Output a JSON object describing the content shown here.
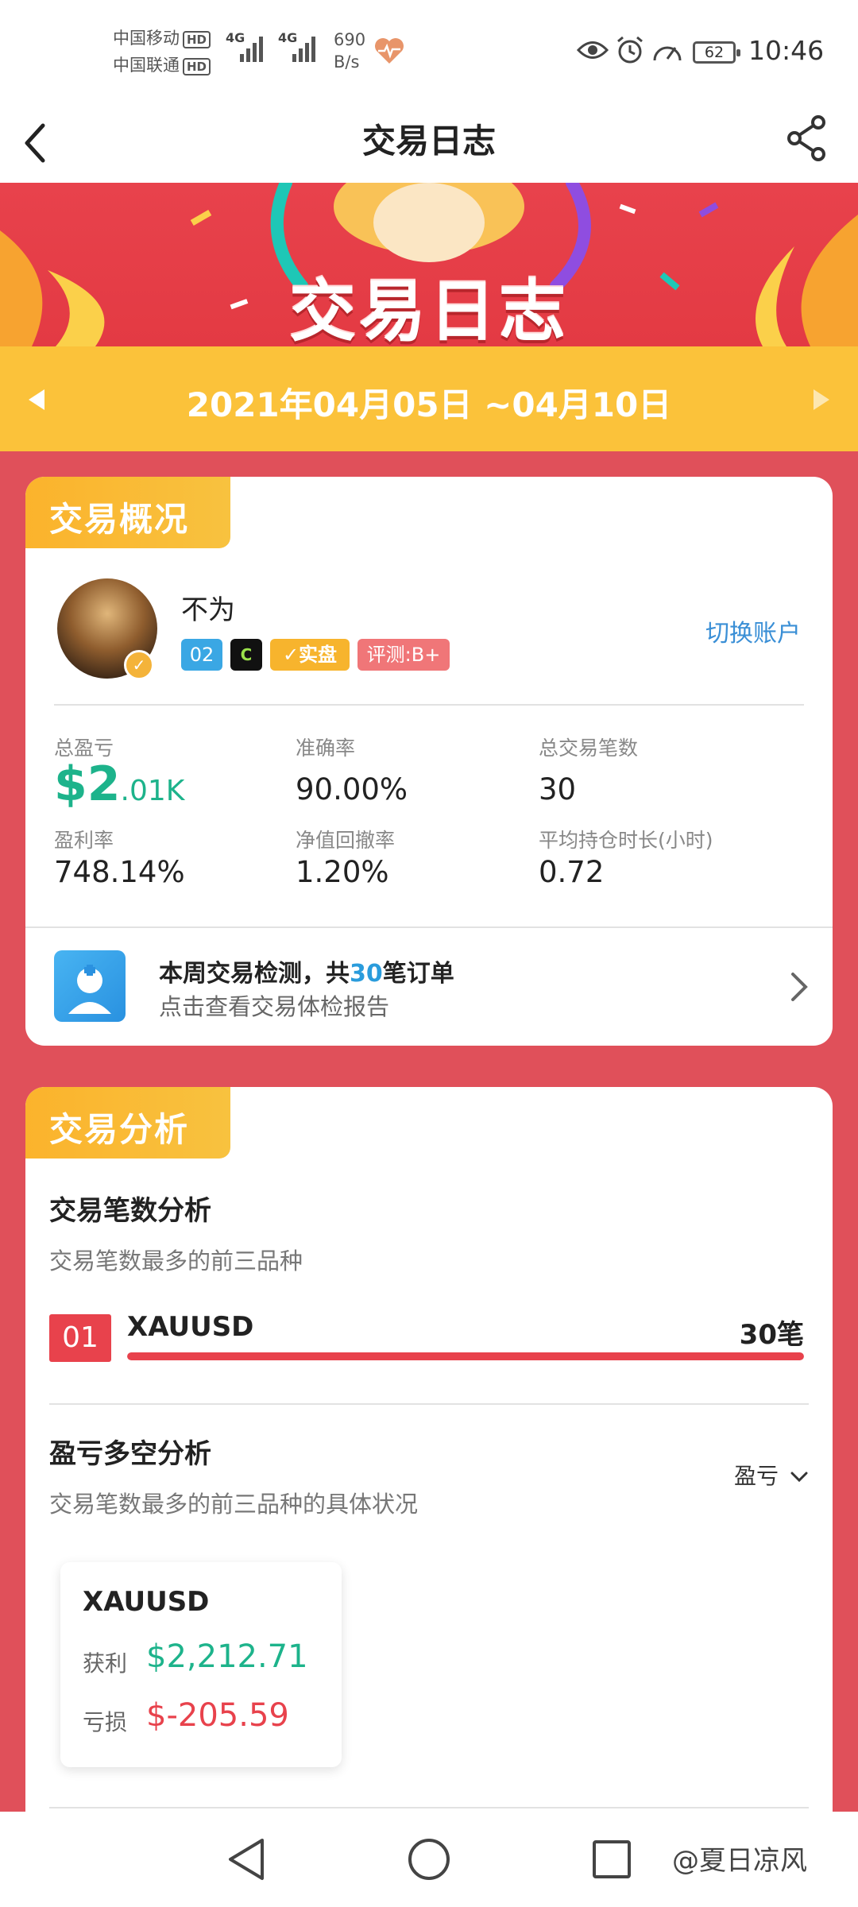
{
  "status_bar": {
    "carrier1": "中国移动",
    "carrier2": "中国联通",
    "hd": "HD",
    "net1": "4G",
    "net2": "4G",
    "speed_value": "690",
    "speed_unit": "B/s",
    "battery": "62",
    "time": "10:46",
    "icons": [
      "heart-rate-icon",
      "eye-icon",
      "alarm-icon",
      "speedometer-icon"
    ]
  },
  "nav": {
    "title": "交易日志",
    "back_icon": "back-arrow-icon",
    "share_icon": "share-icon"
  },
  "banner": {
    "title": "交易日志"
  },
  "date_range": {
    "text": "2021年04月05日 ~04月10日"
  },
  "overview": {
    "tag": "交易概况",
    "username": "不为",
    "badges": [
      "02",
      "C",
      "实盘",
      "评测:B+"
    ],
    "switch_label": "切换账户",
    "stats": {
      "total_pl_label": "总盈亏",
      "total_pl_prefix": "$2",
      "total_pl_suffix": ".01K",
      "accuracy_label": "准确率",
      "accuracy_value": "90.00%",
      "total_trades_label": "总交易笔数",
      "total_trades_value": "30",
      "profit_rate_label": "盈利率",
      "profit_rate_value": "748.14%",
      "drawdown_label": "净值回撤率",
      "drawdown_value": "1.20%",
      "avg_hold_label": "平均持仓时长(小时)",
      "avg_hold_value": "0.72"
    },
    "report": {
      "title_pre": "本周交易检测，共",
      "title_count": "30",
      "title_post": "笔订单",
      "subtitle": "点击查看交易体检报告"
    }
  },
  "analysis": {
    "tag": "交易分析",
    "count_section": {
      "title": "交易笔数分析",
      "subtitle": "交易笔数最多的前三品种",
      "items": [
        {
          "rank": "01",
          "symbol": "XAUUSD",
          "count": "30笔",
          "share": 1.0
        }
      ]
    },
    "pl_section": {
      "title": "盈亏多空分析",
      "subtitle": "交易笔数最多的前三品种的具体状况",
      "dropdown": "盈亏",
      "card": {
        "symbol": "XAUUSD",
        "profit_label": "获利",
        "profit_value": "$2,212.71",
        "loss_label": "亏损",
        "loss_value": "$-205.59"
      }
    }
  },
  "system_nav": {
    "watermark": "@夏日凉风",
    "back": "back-triangle-icon",
    "home": "home-circle-icon",
    "recents": "recents-square-icon"
  },
  "colors": {
    "brand_red": "#e8424c",
    "brand_yellow": "#fbc23a",
    "profit_green": "#1db38b",
    "loss_red": "#e8424c",
    "link_blue": "#3a8fd6"
  }
}
